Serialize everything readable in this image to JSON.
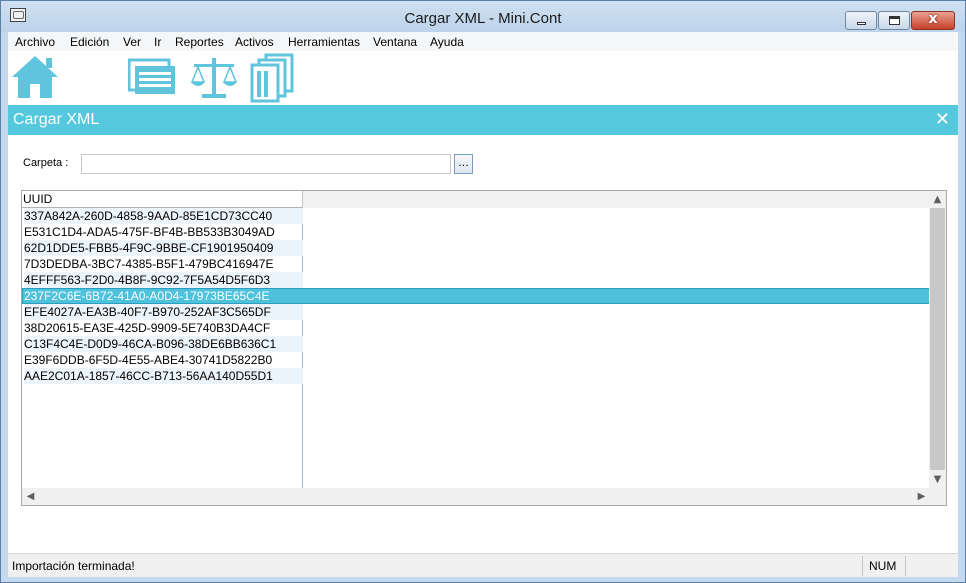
{
  "window": {
    "title": "Cargar XML - Mini.Cont"
  },
  "menu": [
    "Archivo",
    "Edición",
    "Ver",
    "Ir",
    "Reportes",
    "Activos",
    "Herramientas",
    "Ventana",
    "Ayuda"
  ],
  "toolbar": {
    "icons": [
      "home-icon",
      "documents-icon",
      "balance-scale-icon",
      "report-pages-icon"
    ],
    "colors": {
      "accent": "#55c8dd",
      "icon": "#5fc4dc"
    }
  },
  "panel": {
    "title": "Cargar XML",
    "close": "✕"
  },
  "form": {
    "folder_label": "Carpeta :",
    "folder_value": "",
    "browse_label": "..."
  },
  "table": {
    "column": "UUID",
    "rows": [
      "337A842A-260D-4858-9AAD-85E1CD73CC40",
      "E531C1D4-ADA5-475F-BF4B-BB533B3049AD",
      "62D1DDE5-FBB5-4F9C-9BBE-CF1901950409",
      "7D3DEDBA-3BC7-4385-B5F1-479BC416947E",
      "4EFFF563-F2D0-4B8F-9C92-7F5A54D5F6D3",
      "237F2C6E-6B72-41A0-A0D4-17973BE65C4E",
      "EFE4027A-EA3B-40F7-B970-252AF3C565DF",
      "38D20615-EA3E-425D-9909-5E740B3DA4CF",
      "C13F4C4E-D0D9-46CA-B096-38DE6BB636C1",
      "E39F6DDB-6F5D-4E55-ABE4-30741D5822B0",
      "AAE2C01A-1857-46CC-B713-56AA140D55D1"
    ],
    "selected_index": 5
  },
  "status": {
    "message": "Importación terminada!",
    "num": "NUM"
  }
}
